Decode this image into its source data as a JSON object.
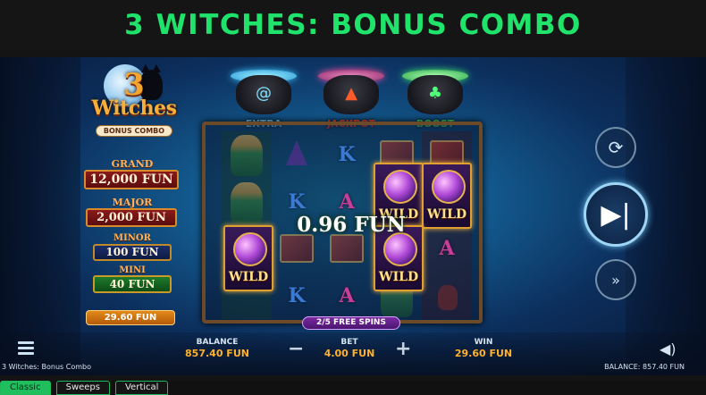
{
  "header": {
    "title": "3 WITCHES: BONUS COMBO"
  },
  "logo": {
    "number": "3",
    "title": "Witches",
    "subtitle": "BONUS COMBO"
  },
  "jackpots": [
    {
      "label": "GRAND",
      "value": "12,000 FUN"
    },
    {
      "label": "MAJOR",
      "value": "2,000 FUN"
    },
    {
      "label": "MINOR",
      "value": "100 FUN"
    },
    {
      "label": "MINI",
      "value": "40 FUN"
    }
  ],
  "total_win_chip": "29.60 FUN",
  "cauldrons": [
    {
      "label": "EXTRA",
      "color": "#3ec8ff",
      "glyph": "swirl"
    },
    {
      "label": "JACKPOT",
      "color": "#ff4a2a",
      "glyph": "fire"
    },
    {
      "label": "BOOST",
      "color": "#3fe56a",
      "glyph": "clover"
    }
  ],
  "reels": [
    [
      "witch",
      "witch",
      "wild",
      "wild"
    ],
    [
      "hat",
      "K",
      "book",
      "K"
    ],
    [
      "K",
      "A",
      "book",
      "A"
    ],
    [
      "book",
      "wild",
      "wild",
      "witch"
    ],
    [
      "book",
      "wild",
      "A",
      "potion"
    ]
  ],
  "wild_label": "WILD",
  "win_amount": "0.96 FUN",
  "free_spins": "2/5 FREE SPINS",
  "controls": {
    "autoplay_icon": "autoplay-icon",
    "spin_icon": "skip-icon",
    "turbo_icon": "fast-forward-icon"
  },
  "bottom_bar": {
    "balance_label": "BALANCE",
    "balance_value": "857.40 FUN",
    "bet_label": "BET",
    "bet_value": "4.00 FUN",
    "win_label": "WIN",
    "win_value": "29.60 FUN",
    "minus": "−",
    "plus": "+",
    "game_name": "3 Witches: Bonus Combo",
    "balance_small": "BALANCE: 857.40 FUN"
  },
  "tabs": [
    {
      "label": "Classic",
      "active": true
    },
    {
      "label": "Sweeps",
      "active": false
    },
    {
      "label": "Vertical",
      "active": false
    }
  ],
  "colors": {
    "header_green": "#1fe36a",
    "value_orange": "#ffb12a",
    "tab_active": "#1fbf5e"
  }
}
